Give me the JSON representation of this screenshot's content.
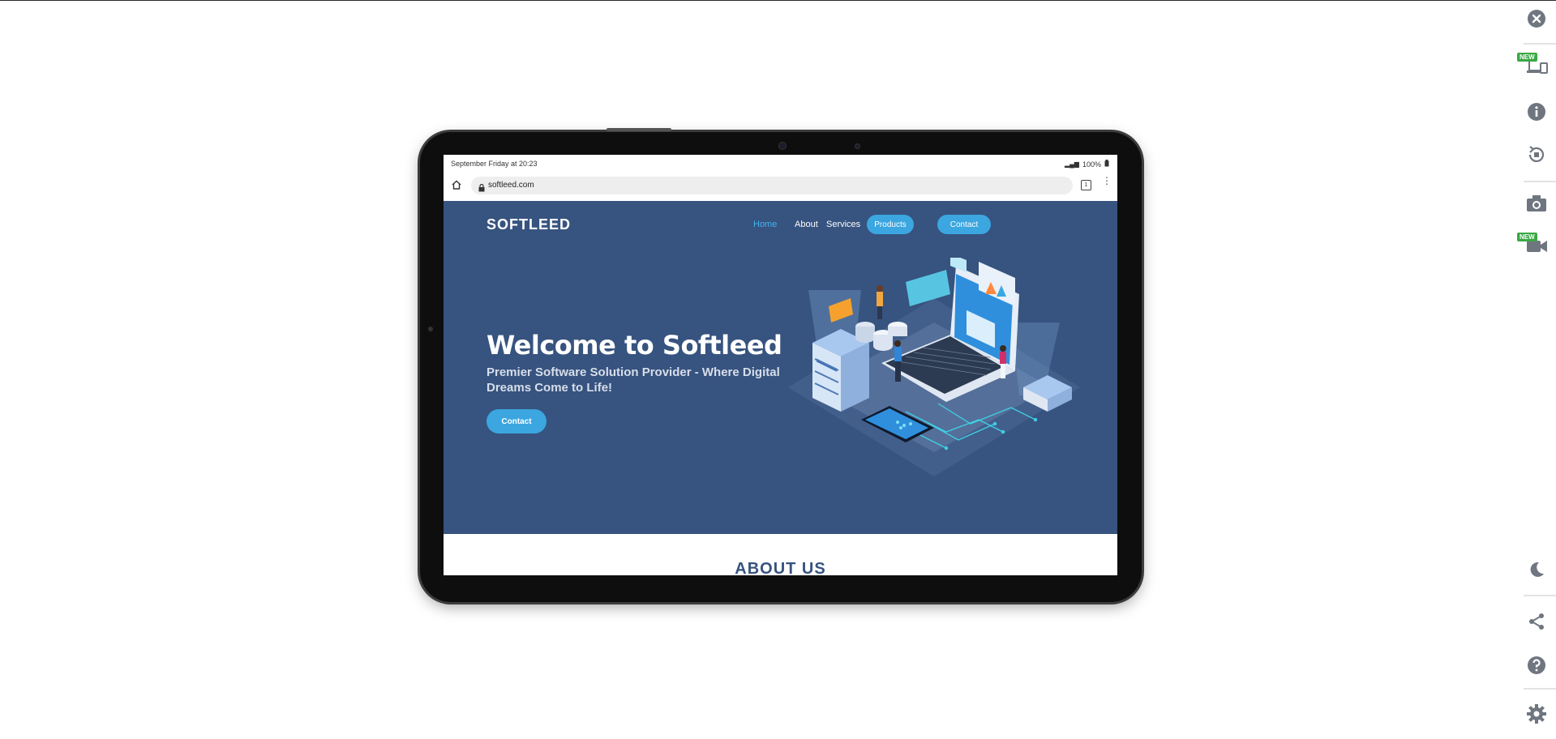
{
  "device": {
    "status_time": "September Friday at 20:23",
    "battery": "100%",
    "url": "softleed.com",
    "tab_count": "1"
  },
  "site": {
    "brand": "SOFTLEED",
    "nav": {
      "home": "Home",
      "about": "About",
      "services": "Services",
      "products": "Products",
      "contact": "Contact"
    },
    "hero": {
      "title": "Welcome to Softleed",
      "subtitle": "Premier Software Solution Provider - Where Digital Dreams Come to Life!",
      "cta": "Contact"
    },
    "next_section": "ABOUT US"
  },
  "toolbar": {
    "items": [
      "close-icon",
      "devices-icon",
      "info-icon",
      "rotate-icon",
      "camera-icon",
      "video-icon",
      "dark-mode-icon",
      "share-icon",
      "help-icon",
      "settings-icon"
    ],
    "new_badge": "NEW"
  },
  "colors": {
    "hero_bg": "#37537f",
    "accent": "#3ba6e0",
    "toolbar_icon": "#6f7680",
    "badge": "#3aa845"
  }
}
